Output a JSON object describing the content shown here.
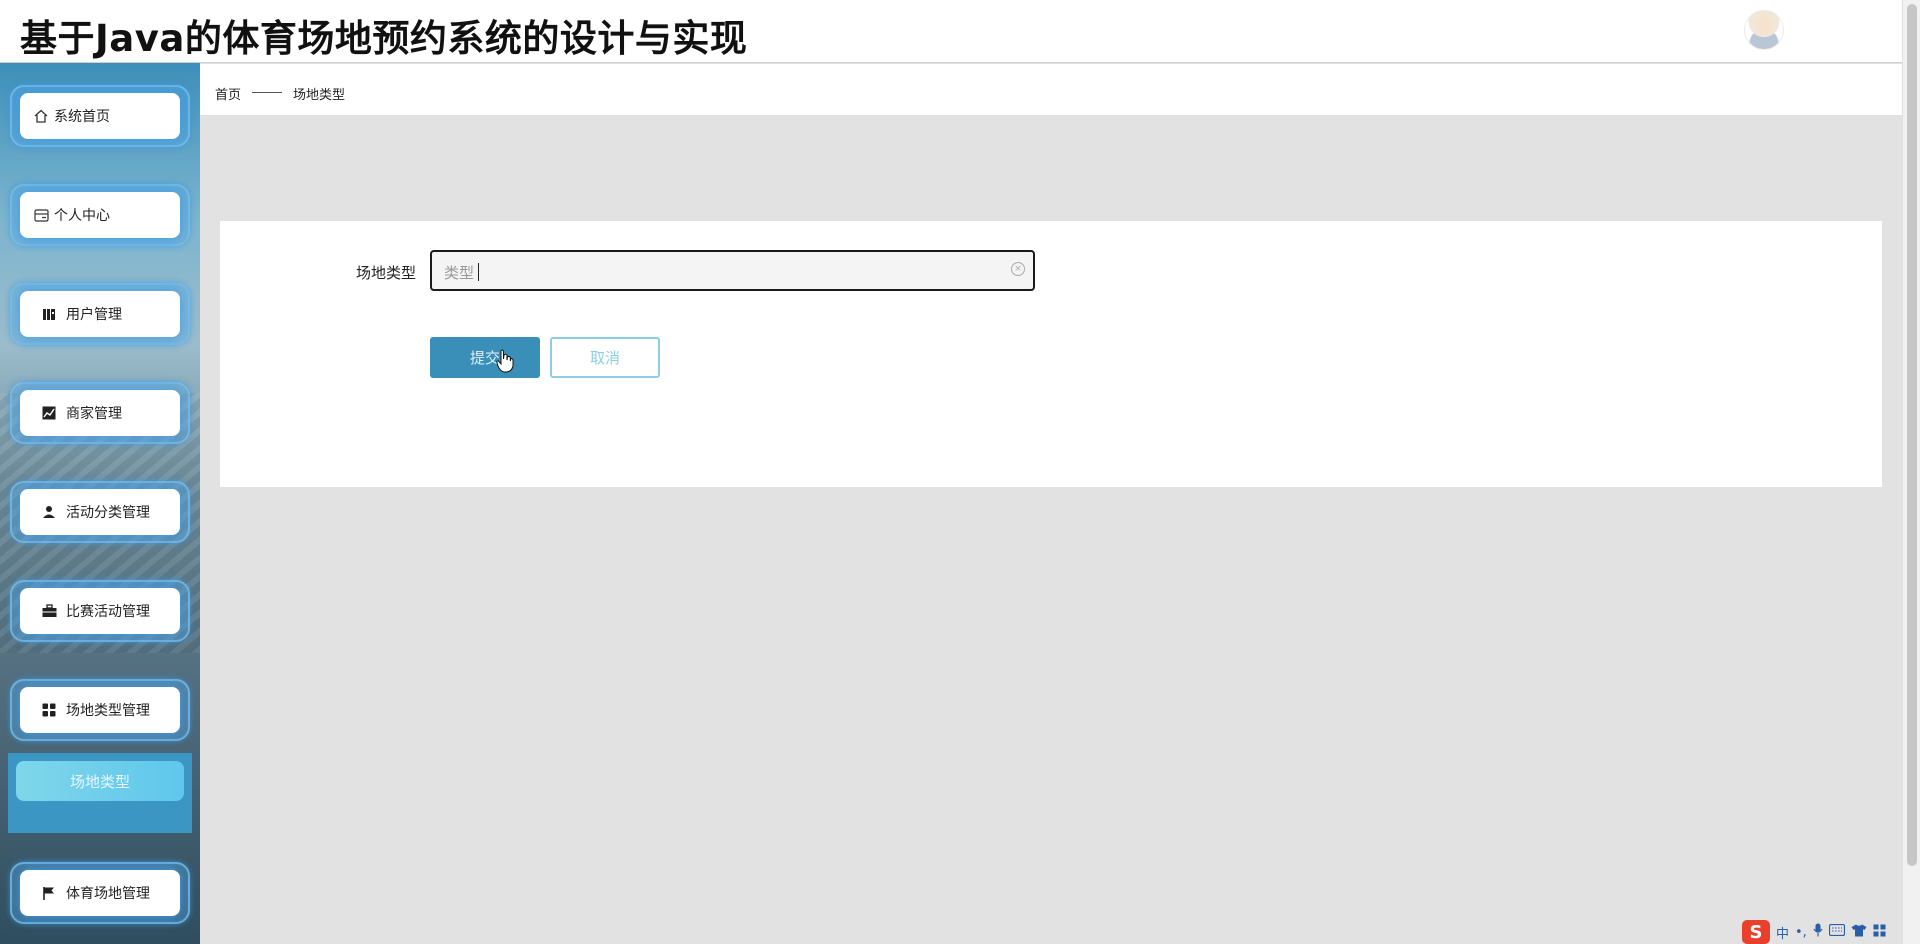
{
  "header": {
    "app_title": "基于Java的体育场地预约系统的设计与实现",
    "avatar_icon": "avatar-icon"
  },
  "sidebar": {
    "items": [
      {
        "label": "系统首页",
        "icon": "home-icon"
      },
      {
        "label": "个人中心",
        "icon": "card-icon"
      },
      {
        "label": "用户管理",
        "icon": "users-icon"
      },
      {
        "label": "商家管理",
        "icon": "chart-icon"
      },
      {
        "label": "活动分类管理",
        "icon": "person-icon"
      },
      {
        "label": "比赛活动管理",
        "icon": "briefcase-icon"
      },
      {
        "label": "场地类型管理",
        "icon": "grid-icon"
      },
      {
        "label": "体育场地管理",
        "icon": "flag-icon"
      }
    ],
    "submenu": {
      "active_label": "场地类型"
    }
  },
  "breadcrumb": {
    "home": "首页",
    "current": "场地类型"
  },
  "form": {
    "field_label": "场地类型",
    "field_value": "类型",
    "submit_label": "提交",
    "cancel_label": "取消"
  },
  "tray": {
    "ime_logo": "S",
    "ime_mode": "中",
    "punct": "•,",
    "mic_icon": "mic-icon",
    "keyboard_icon": "keyboard-icon",
    "shirt_icon": "shirt-icon",
    "apps_icon": "apps-icon"
  },
  "colors": {
    "primary": "#3a8fb8",
    "cancel_border": "#8ccfe4",
    "submenu_active": "#5fc7ec",
    "glow": "#46a0e6"
  }
}
